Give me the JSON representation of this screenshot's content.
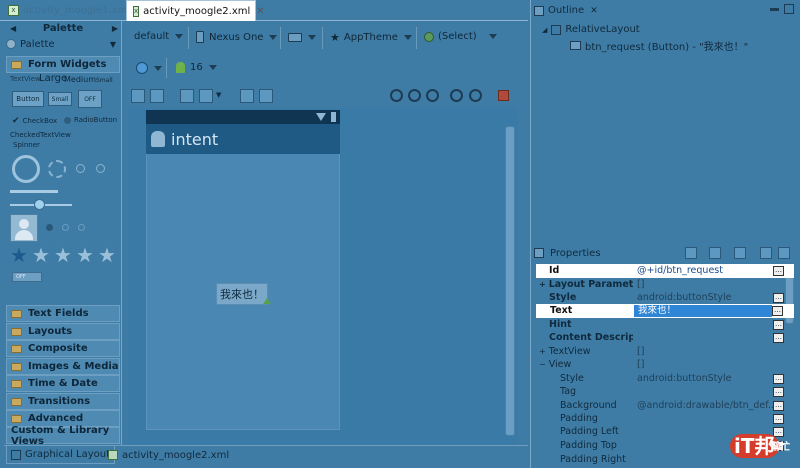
{
  "editor_tabs": [
    {
      "label": "activity_moogle1.xml",
      "active": false
    },
    {
      "label": "activity_moogle2.xml",
      "active": true
    }
  ],
  "palette": {
    "title": "Palette",
    "dropdown_label": "Palette",
    "section_open": "Form Widgets",
    "widgets": {
      "textview": "TextView",
      "large": "Large",
      "medium": "Medium",
      "small": "Small",
      "button": "Button",
      "small_button": "Small",
      "toggle": "OFF",
      "checkbox": "CheckBox",
      "radio": "RadioButton",
      "checked_textview": "CheckedTextView",
      "spinner": "Spinner",
      "switch": "OFF"
    },
    "categories": [
      "Text Fields",
      "Layouts",
      "Composite",
      "Images & Media",
      "Time & Date",
      "Transitions",
      "Advanced"
    ],
    "custom": "Custom & Library Views"
  },
  "toolbar": {
    "config": "default",
    "device": "Nexus One",
    "theme": "AppTheme",
    "activity": "(Select)",
    "api_level": "16"
  },
  "preview": {
    "app_title": "intent",
    "button_text": "我來也！"
  },
  "bottom_tabs": [
    "Graphical Layout",
    "activity_moogle2.xml"
  ],
  "outline": {
    "title": "Outline",
    "root": "RelativeLayout",
    "child": "btn_request (Button) - \"我來也！\""
  },
  "properties": {
    "title": "Properties",
    "rows": [
      {
        "key": "Id",
        "value": "@+id/btn_request",
        "bold": true,
        "highlight": true,
        "dots": true
      },
      {
        "key": "Layout Parameters",
        "value": "[]",
        "bold": true,
        "expander": "+"
      },
      {
        "key": "Style",
        "value": "android:buttonStyle",
        "bold": true,
        "dots": true
      },
      {
        "key": "Text",
        "value": "我來也！",
        "bold": true,
        "selected": true,
        "dots": true
      },
      {
        "key": "Hint",
        "value": "",
        "bold": true,
        "dots": true
      },
      {
        "key": "Content Descript...",
        "value": "",
        "bold": true,
        "dots": true
      },
      {
        "key": "TextView",
        "value": "[]",
        "expander": "+"
      },
      {
        "key": "View",
        "value": "[]",
        "expander": "−"
      },
      {
        "key": "Style",
        "value": "android:buttonStyle",
        "indent": true,
        "dots": true
      },
      {
        "key": "Tag",
        "value": "",
        "indent": true,
        "dots": true
      },
      {
        "key": "Background",
        "value": "@android:drawable/btn_def...",
        "indent": true,
        "dots": true
      },
      {
        "key": "Padding",
        "value": "",
        "indent": true,
        "dots": true
      },
      {
        "key": "Padding Left",
        "value": "",
        "indent": true,
        "dots": true
      },
      {
        "key": "Padding Top",
        "value": "",
        "indent": true,
        "dots": true
      },
      {
        "key": "Padding Right",
        "value": "",
        "indent": true
      }
    ]
  },
  "watermark": {
    "main": "iT邦",
    "sub": "幫忙"
  },
  "colors": {
    "accent": "#3e7ca6",
    "selected": "#2f86d6",
    "highlight": "#ffffff",
    "watermark": "#d43c2c"
  }
}
